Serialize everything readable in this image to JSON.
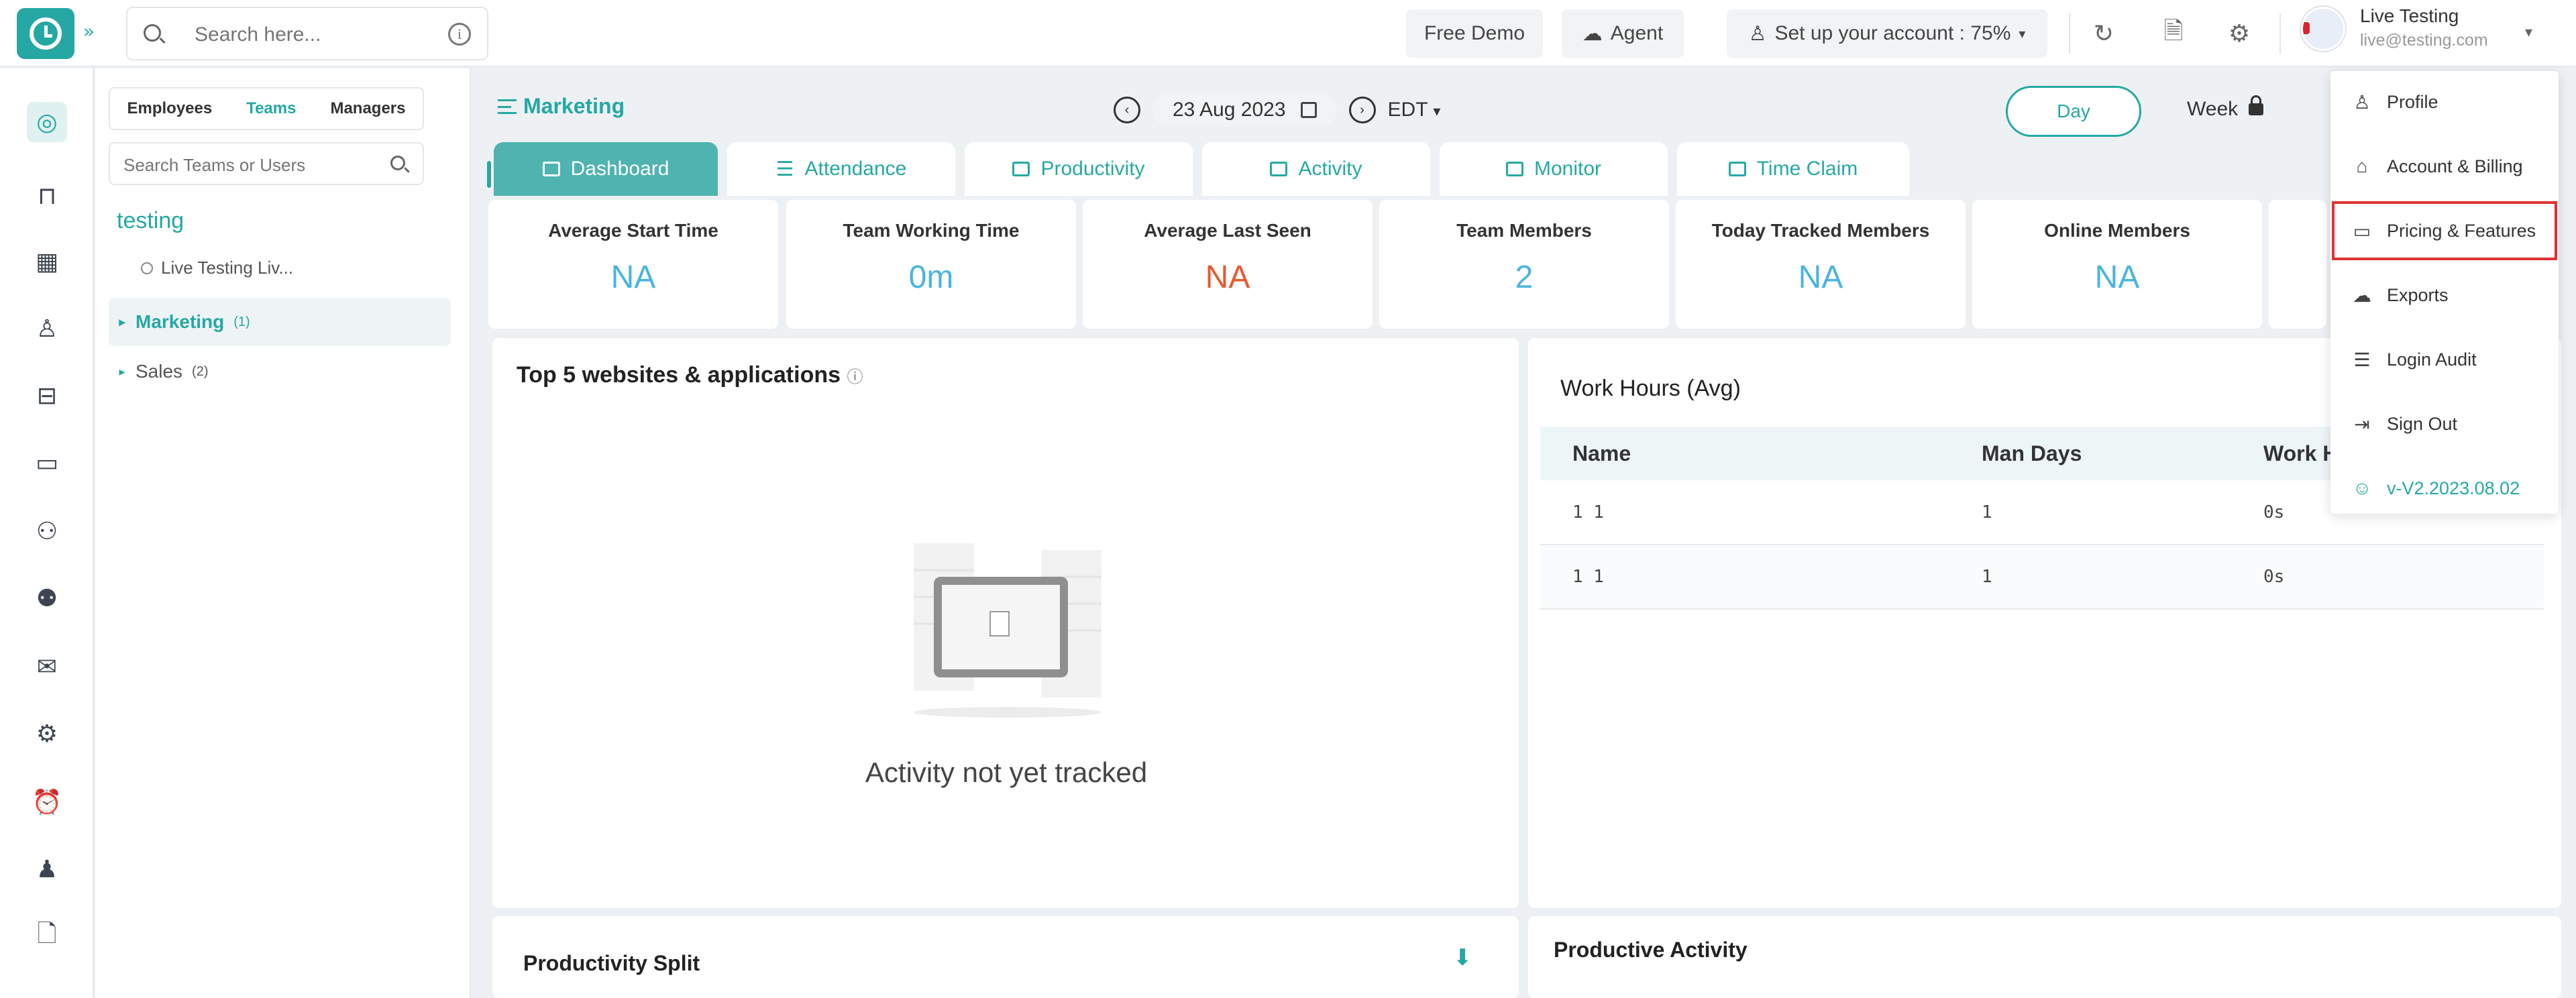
{
  "colors": {
    "accent": "#25a8a4",
    "alert": "#e85a2e",
    "highlight_border": "#e03232"
  },
  "topbar": {
    "search_placeholder": "Search here...",
    "free_demo": "Free Demo",
    "agent": "Agent",
    "setup": "Set up your account : 75%",
    "user_name": "Live Testing",
    "user_email": "live@testing.com"
  },
  "team_panel": {
    "tabs": [
      "Employees",
      "Teams",
      "Managers"
    ],
    "active_tab": "Teams",
    "search_placeholder": "Search Teams or Users",
    "org": "testing",
    "member": "Live Testing Liv...",
    "teams": [
      {
        "name": "Marketing",
        "count": "(1)"
      },
      {
        "name": "Sales",
        "count": "(2)"
      }
    ]
  },
  "header": {
    "breadcrumb": "Marketing",
    "date": "23 Aug 2023",
    "timezone": "EDT",
    "day": "Day",
    "week": "Week"
  },
  "tabs": [
    {
      "label": "Dashboard",
      "active": true
    },
    {
      "label": "Attendance"
    },
    {
      "label": "Productivity"
    },
    {
      "label": "Activity"
    },
    {
      "label": "Monitor"
    },
    {
      "label": "Time Claim"
    }
  ],
  "stats": [
    {
      "label": "Average Start Time",
      "value": "NA"
    },
    {
      "label": "Team Working Time",
      "value": "0m"
    },
    {
      "label": "Average Last Seen",
      "value": "NA"
    },
    {
      "label": "Team Members",
      "value": "2"
    },
    {
      "label": "Today Tracked Members",
      "value": "NA"
    },
    {
      "label": "Online Members",
      "value": "NA"
    }
  ],
  "top_websites": {
    "title": "Top 5 websites & applications",
    "empty_message": "Activity not yet tracked"
  },
  "work_hours": {
    "title": "Work Hours (Avg)",
    "columns": [
      "Name",
      "Man Days",
      "Work H"
    ],
    "rows": [
      [
        "1 1",
        "1",
        "0s"
      ],
      [
        "1 1",
        "1",
        "0s"
      ]
    ]
  },
  "bottom": {
    "productivity_split": "Productivity Split",
    "productive_activity": "Productive Activity"
  },
  "dropdown": {
    "items": [
      "Profile",
      "Account & Billing",
      "Pricing & Features",
      "Exports",
      "Login Audit",
      "Sign Out"
    ],
    "version": "v-V2.2023.08.02"
  }
}
